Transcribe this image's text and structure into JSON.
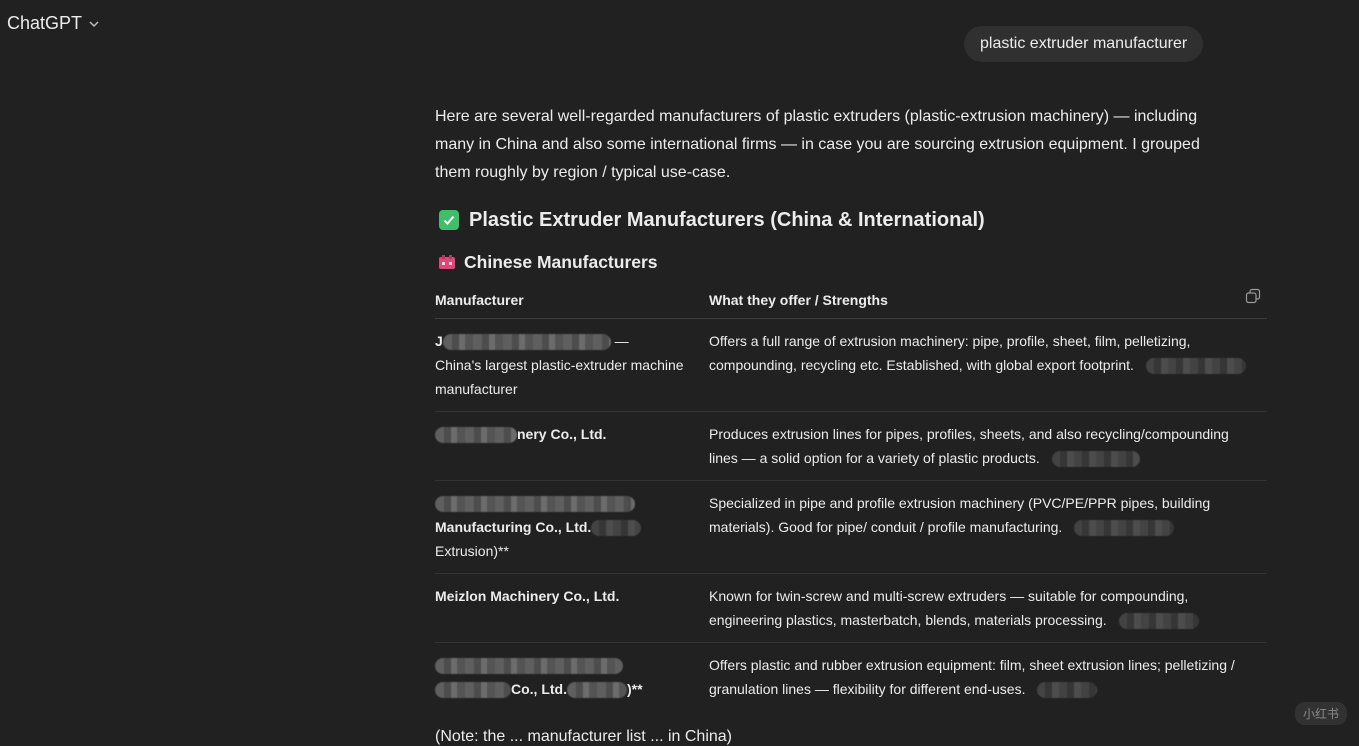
{
  "header": {
    "app_title": "ChatGPT",
    "chevron_icon": "chevron-down-icon"
  },
  "user_message": "plastic extruder manufacturer",
  "reply": {
    "intro": "Here are several well-regarded manufacturers of plastic extruders (plastic-extrusion machinery) — including many in China and also some international firms — in case you are sourcing extrusion equipment. I grouped them roughly by region / typical use-case.",
    "heading": "Plastic Extruder Manufacturers (China & International)",
    "heading_icon": "check-box-icon",
    "subheading": "Chinese Manufacturers",
    "subheading_icon": "factory-icon",
    "table": {
      "headers": [
        "Manufacturer",
        "What they offer / Strengths"
      ],
      "rows": [
        {
          "name_prefix": "J",
          "name_suffix": " —",
          "name_rest": "China's largest plastic-extruder machine manufacturer",
          "offer": "Offers a full range of extrusion machinery: pipe, profile, sheet, film, pelletizing, compounding, recycling etc. Established, with global export footprint."
        },
        {
          "name_suffix": "nery Co., Ltd.",
          "offer": "Produces extrusion lines for pipes, profiles, sheets, and also recycling/compounding lines — a solid option for a variety of plastic products."
        },
        {
          "name_line2": "Manufacturing Co., Ltd.",
          "name_line3": "Extrusion)**",
          "offer": "Specialized in pipe and profile extrusion machinery (PVC/PE/PPR pipes, building materials). Good for pipe/ conduit / profile manufacturing."
        },
        {
          "name": "Meizlon Machinery Co., Ltd.",
          "offer": "Known for twin-screw and multi-screw extruders — suitable for compounding, engineering plastics, masterbatch, blends, materials processing."
        },
        {
          "name_mid": "Co., Ltd.",
          "name_end": ")**",
          "offer": "Offers plastic and rubber extrusion equipment: film, sheet extrusion lines; pelletizing / granulation lines — flexibility for different end-uses."
        }
      ]
    },
    "footnote": "(Note: the ... manufacturer list ... in China)"
  },
  "watermark": "小红书",
  "colors": {
    "background": "#212121",
    "bubble": "#303030",
    "text": "#ececec",
    "check": "#3fbf6b"
  }
}
